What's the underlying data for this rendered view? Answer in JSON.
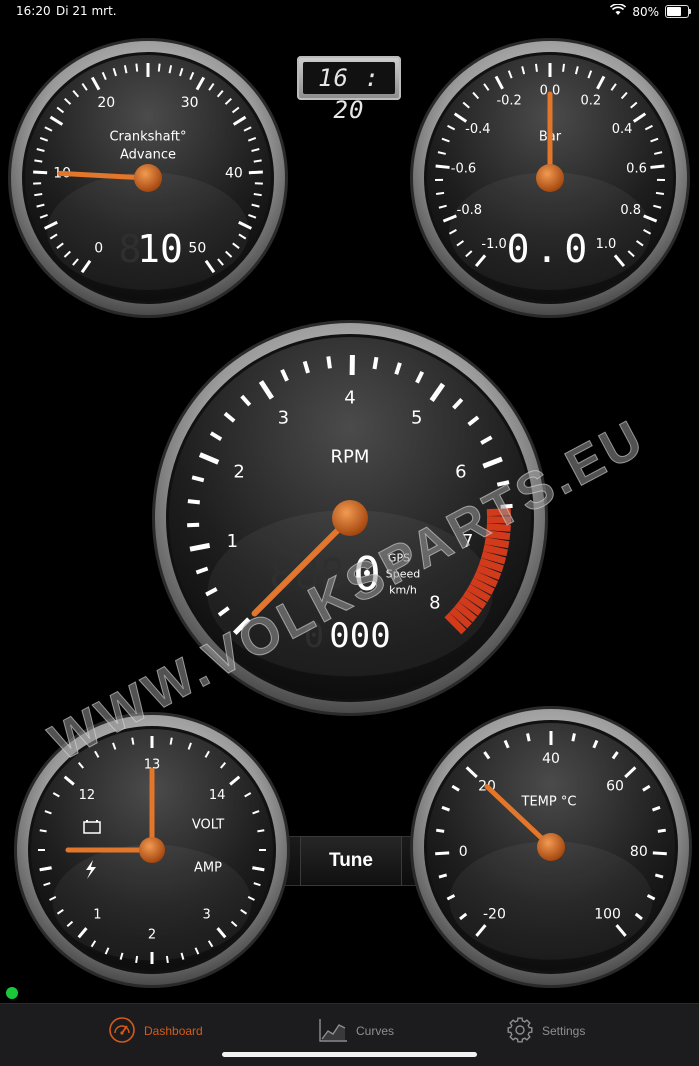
{
  "status_bar": {
    "time": "16:20",
    "date": "Di 21 mrt.",
    "battery": "80%",
    "battery_level": 0.8
  },
  "clock": {
    "display": "16 : 20"
  },
  "gauges": {
    "advance": {
      "title_line1": "Crankshaft°",
      "title_line2": "Advance",
      "ticks": [
        "0",
        "10",
        "20",
        "30",
        "40",
        "50"
      ],
      "readout_dim": "8",
      "readout": "10",
      "needle_value": 10
    },
    "boost": {
      "unit": "Bar",
      "ticks": [
        "-1.0",
        "-0.8",
        "-0.6",
        "-0.4",
        "-0.2",
        "0.0",
        "0.2",
        "0.4",
        "0.6",
        "0.8",
        "1.0"
      ],
      "readout": "0.0",
      "needle_value": 0
    },
    "rpm": {
      "unit": "RPM",
      "ticks": [
        "1",
        "2",
        "3",
        "4",
        "5",
        "6",
        "7",
        "8"
      ],
      "speed_readout_dim": "888",
      "speed_readout": "0",
      "speed_label_1": "GPS",
      "speed_label_2": "Speed",
      "speed_label_3": "km/h",
      "odometer_dim": "0",
      "odometer": "000",
      "needle_value": 0,
      "redline_from": 6.6
    },
    "volt_amp": {
      "volt_label": "VOLT",
      "amp_label": "AMP",
      "volt_ticks": [
        "12",
        "13",
        "14"
      ],
      "amp_ticks": [
        "1",
        "2",
        "3"
      ],
      "volt_value": 13,
      "amp_value": 0
    },
    "temp": {
      "label": "TEMP °C",
      "ticks": [
        "-20",
        "0",
        "20",
        "40",
        "60",
        "80",
        "100"
      ],
      "needle_value": 20
    }
  },
  "tune_button": {
    "label": "Tune"
  },
  "watermark": {
    "text": "WWW.VOLKSPARTS.EU"
  },
  "tabbar": {
    "tabs": [
      {
        "label": "Dashboard",
        "icon": "speedometer-icon",
        "active": true
      },
      {
        "label": "Curves",
        "icon": "chart-icon",
        "active": false
      },
      {
        "label": "Settings",
        "icon": "gear-icon",
        "active": false
      }
    ]
  },
  "colors": {
    "accent": "#d55a1a",
    "needle": "#e2762a",
    "redline": "#d23a1c",
    "active_dot": "#19c93a"
  }
}
